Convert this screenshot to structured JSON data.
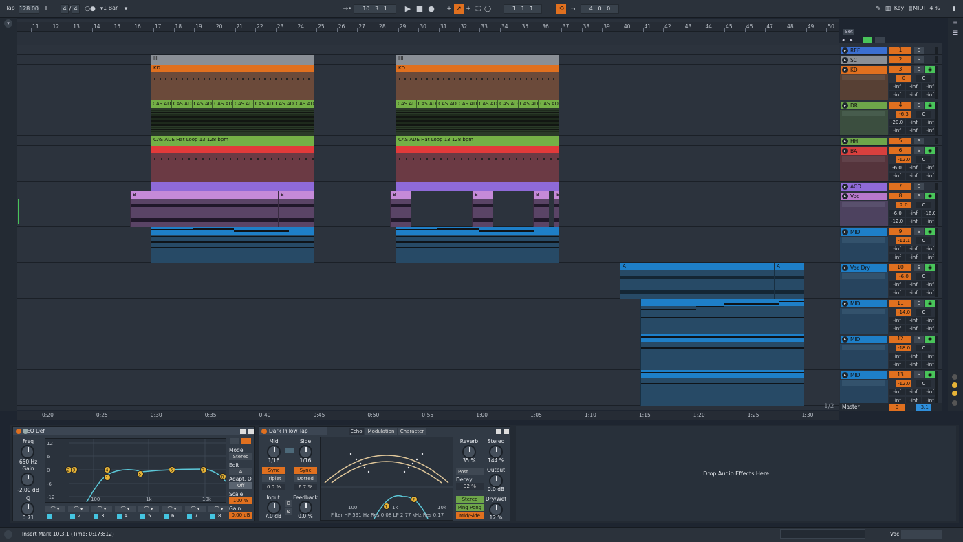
{
  "transport": {
    "tap": "Tap",
    "tempo": "128.00",
    "signature_num": "4",
    "signature_den": "4",
    "quantize": "1 Bar",
    "position": "10 .  3 .  1",
    "loop_start": "1 .  1 .  1",
    "loop_length": "4 .  0 .  0",
    "key_label": "Key",
    "midi_label": "MIDI",
    "cpu": "4 %"
  },
  "ruler": {
    "bars": [
      "11",
      "12",
      "13",
      "14",
      "15",
      "16",
      "17",
      "18",
      "19",
      "20",
      "21",
      "22",
      "23",
      "24",
      "25",
      "26",
      "27",
      "28",
      "29",
      "30",
      "31",
      "32",
      "33",
      "34",
      "35",
      "36",
      "37",
      "38",
      "39",
      "40",
      "41",
      "42",
      "43",
      "44",
      "45",
      "46",
      "47",
      "48",
      "49",
      "50"
    ]
  },
  "timebar": {
    "times": [
      "0:20",
      "0:25",
      "0:30",
      "0:35",
      "0:40",
      "0:45",
      "0:50",
      "0:55",
      "1:00",
      "1:05",
      "1:10",
      "1:15",
      "1:20",
      "1:25",
      "1:30"
    ],
    "page": "1/2"
  },
  "set_label": "Set",
  "clips": {
    "hi": "HI",
    "kd": "KD",
    "dr_slice": "CAS ADE",
    "hh": "CAS ADE Hat Loop 13 128 bpm",
    "voc_b": "B",
    "vocdry_a": "A"
  },
  "tracks": [
    {
      "name": "REF",
      "num": "1",
      "color": "#3b6fd1",
      "vol": "",
      "pan": ""
    },
    {
      "name": "SC",
      "num": "2",
      "color": "#8a8f96",
      "vol": "",
      "pan": ""
    },
    {
      "name": "KD",
      "num": "3",
      "color": "#e0701f",
      "vol": "0",
      "pan": "C",
      "sends": [
        "-inf",
        "-inf",
        "-inf",
        "-inf",
        "-inf",
        "-inf"
      ]
    },
    {
      "name": "DR",
      "num": "4",
      "color": "#6ea64a",
      "vol": "-6.3",
      "pan": "C",
      "sends": [
        "-20.0",
        "-inf",
        "-inf",
        "-inf",
        "-inf",
        "-inf"
      ]
    },
    {
      "name": "HH",
      "num": "5",
      "color": "#6ea64a",
      "vol": "",
      "pan": ""
    },
    {
      "name": "BA",
      "num": "6",
      "color": "#d8403e",
      "vol": "-12.0",
      "pan": "C",
      "sends": [
        "-6.0",
        "-inf",
        "-inf",
        "-inf",
        "-inf",
        "-inf"
      ]
    },
    {
      "name": "ACD",
      "num": "7",
      "color": "#8f6ad8",
      "vol": "",
      "pan": ""
    },
    {
      "name": "Voc",
      "num": "8",
      "color": "#b878cc",
      "vol": "2.0",
      "pan": "C",
      "sends": [
        "-6.0",
        "-inf",
        "-16.0",
        "-12.0",
        "-inf",
        "-inf"
      ]
    },
    {
      "name": "MIDI",
      "num": "9",
      "color": "#1e7fc8",
      "vol": "-11.1",
      "pan": "C",
      "sends": [
        "-inf",
        "-inf",
        "-inf",
        "-inf",
        "-inf",
        "-inf"
      ]
    },
    {
      "name": "Voc Dry",
      "num": "10",
      "color": "#1e7fc8",
      "vol": "-6.0",
      "pan": "C",
      "sends": [
        "-inf",
        "-inf",
        "-inf",
        "-inf",
        "-inf",
        "-inf"
      ]
    },
    {
      "name": "MIDI",
      "num": "11",
      "color": "#1e7fc8",
      "vol": "-14.0",
      "pan": "C",
      "sends": [
        "-inf",
        "-inf",
        "-inf",
        "-inf",
        "-inf",
        "-inf"
      ]
    },
    {
      "name": "MIDI",
      "num": "12",
      "color": "#1e7fc8",
      "vol": "-18.0",
      "pan": "C",
      "sends": [
        "-inf",
        "-inf",
        "-inf",
        "-inf",
        "-inf",
        "-inf"
      ]
    },
    {
      "name": "MIDI",
      "num": "13",
      "color": "#1e7fc8",
      "vol": "-12.0",
      "pan": "C",
      "sends": [
        "-inf",
        "-inf",
        "-inf",
        "-inf",
        "-inf",
        "-inf"
      ]
    }
  ],
  "master": {
    "name": "Master",
    "vol": "0",
    "pan": "-3.1"
  },
  "eq": {
    "title": "EQ Def",
    "freq_label": "Freq",
    "freq": "650 Hz",
    "gain_label": "Gain",
    "gain": "-2.00 dB",
    "q_label": "Q",
    "q": "0.71",
    "mode_label": "Mode",
    "mode": "Stereo",
    "edit_label": "Edit",
    "edit": "A",
    "adapt_label": "Adapt. Q",
    "adapt": "Off",
    "scale_label": "Scale",
    "scale": "100 %",
    "gain2_label": "Gain",
    "gain2": "0.00 dB",
    "db_ticks": [
      "12",
      "6",
      "0",
      "-6",
      "-12"
    ],
    "freq_ticks": [
      "100",
      "1k",
      "10k"
    ],
    "bands": [
      "1",
      "2",
      "3",
      "4",
      "5",
      "6",
      "7",
      "8"
    ],
    "points": [
      "2",
      "3",
      "4",
      "1",
      "5",
      "6",
      "7",
      "8"
    ]
  },
  "delay": {
    "title": "Dark Pillow Tap",
    "tabs": [
      "Echo",
      "Modulation",
      "Character"
    ],
    "mid_label": "Mid",
    "mid": "1/16",
    "side_label": "Side",
    "side": "1/16",
    "sync": "Sync",
    "triplet": "Triplet",
    "dotted": "Dotted",
    "mid_off": "0.0 %",
    "side_off": "6.7 %",
    "input_label": "Input",
    "input": "7.0 dB",
    "feedback_label": "Feedback",
    "feedback": "0.0 %",
    "d_l": "D",
    "d_r": "Ø",
    "filter_ticks": [
      "100",
      "1k",
      "10k"
    ],
    "filter_text": "Filter HP 591 Hz   Res 0.08   LP 2.77 kHz   Res 0.17",
    "filter_pts": [
      "1",
      "2"
    ],
    "reverb_label": "Reverb",
    "reverb": "35 %",
    "stereo_label": "Stereo",
    "stereo": "144 %",
    "post": "Post",
    "decay_label": "Decay",
    "decay": "32 %",
    "output_label": "Output",
    "output": "0.0 dB",
    "stereo_btn": "Stereo",
    "pingpong_btn": "Ping Pong",
    "midside_btn": "Mid/Side",
    "drywet_label": "Dry/Wet",
    "drywet": "12 %"
  },
  "drop_text": "Drop Audio Effects Here",
  "status": {
    "message": "Insert Mark 10.3.1 (Time: 0:17:812)",
    "track": "Voc"
  }
}
